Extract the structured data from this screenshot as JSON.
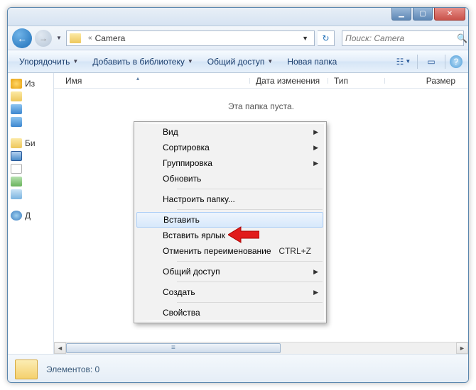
{
  "titlebar": {
    "min": "▁",
    "max": "▢",
    "close": "✕"
  },
  "nav": {
    "back": "←",
    "fwd": "→",
    "drop": "▼",
    "crumb_sep": "«",
    "path_label": "Camera",
    "addr_drop": "▼",
    "refresh": "↻",
    "search_placeholder": "Поиск: Camera",
    "search_icon": "🔍"
  },
  "toolbar": {
    "organize": "Упорядочить",
    "add_library": "Добавить в библиотеку",
    "share": "Общий доступ",
    "new_folder": "Новая папка",
    "drop": "▼",
    "view_icon": "☷",
    "preview_icon": "▭",
    "help_icon": "?"
  },
  "columns": {
    "name": "Имя",
    "date": "Дата изменения",
    "type": "Тип",
    "size": "Размер",
    "sort": "▴"
  },
  "empty_folder_text": "Эта папка пуста.",
  "sidebar": {
    "fav": "Из",
    "lib": "Би",
    "net": "Д"
  },
  "status": {
    "items_label": "Элементов: 0"
  },
  "ctx": {
    "view": "Вид",
    "sort": "Сортировка",
    "group": "Группировка",
    "refresh": "Обновить",
    "customize": "Настроить папку...",
    "paste": "Вставить",
    "paste_shortcut": "Вставить ярлык",
    "undo_rename": "Отменить переименование",
    "undo_shortcut": "CTRL+Z",
    "share": "Общий доступ",
    "new": "Создать",
    "properties": "Свойства",
    "submenu": "▶"
  }
}
